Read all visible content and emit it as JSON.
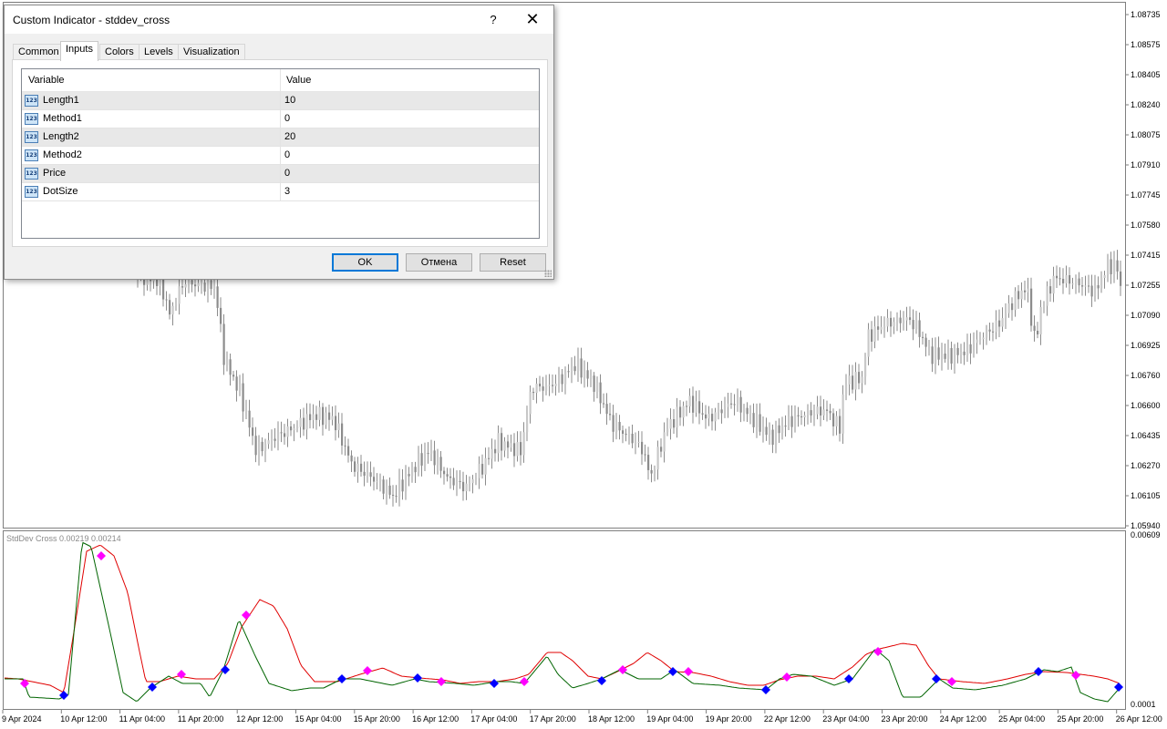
{
  "chart": {
    "main_y_ticks": [
      "1.08735",
      "1.08575",
      "1.08405",
      "1.08240",
      "1.08075",
      "1.07910",
      "1.07745",
      "1.07580",
      "1.07415",
      "1.07255",
      "1.07090",
      "1.06925",
      "1.06760",
      "1.06600",
      "1.06435",
      "1.06270",
      "1.06105",
      "1.05940"
    ],
    "sub_y_ticks": [
      "0.00609",
      "0.0001"
    ],
    "x_ticks": [
      "9 Apr 2024",
      "10 Apr 12:00",
      "11 Apr 04:00",
      "11 Apr 20:00",
      "12 Apr 12:00",
      "15 Apr 04:00",
      "15 Apr 20:00",
      "16 Apr 12:00",
      "17 Apr 04:00",
      "17 Apr 20:00",
      "18 Apr 12:00",
      "19 Apr 04:00",
      "19 Apr 20:00",
      "22 Apr 12:00",
      "23 Apr 04:00",
      "23 Apr 20:00",
      "24 Apr 12:00",
      "25 Apr 04:00",
      "25 Apr 20:00",
      "26 Apr 12:00"
    ],
    "indicator_label": "StdDev Cross 0.00219 0.00214",
    "colors": {
      "candle": "#8c8c8c",
      "line_fast": "#006400",
      "line_slow": "#e00000",
      "dot_up": "#0000ff",
      "dot_down": "#ff00ff"
    }
  },
  "dialog": {
    "title": "Custom Indicator - stddev_cross",
    "help": "?",
    "close": "✕",
    "tabs": [
      {
        "label": "Common",
        "active": false
      },
      {
        "label": "Inputs",
        "active": true
      },
      {
        "label": "Colors",
        "active": false
      },
      {
        "label": "Levels",
        "active": false
      },
      {
        "label": "Visualization",
        "active": false
      }
    ],
    "grid": {
      "headers": {
        "variable": "Variable",
        "value": "Value"
      },
      "icon_text": "123",
      "rows": [
        {
          "name": "Length1",
          "value": "10"
        },
        {
          "name": "Method1",
          "value": "0"
        },
        {
          "name": "Length2",
          "value": "20"
        },
        {
          "name": "Method2",
          "value": "0"
        },
        {
          "name": "Price",
          "value": "0"
        },
        {
          "name": "DotSize",
          "value": "3"
        }
      ]
    },
    "buttons": {
      "ok": "OK",
      "cancel": "Отмена",
      "reset": "Reset"
    }
  }
}
